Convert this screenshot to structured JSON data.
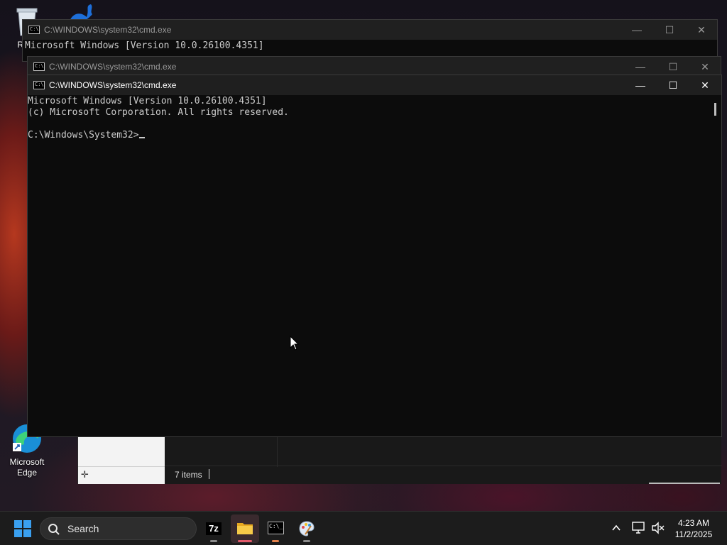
{
  "desktop": {
    "icons": [
      {
        "label": "Recy"
      },
      {
        "label": "Microsoft Edge"
      }
    ]
  },
  "explorer": {
    "status_items": "7 items"
  },
  "windows": [
    {
      "title": "C:\\WINDOWS\\system32\\cmd.exe",
      "lines": [
        "Microsoft Windows [Version 10.0.26100.4351]"
      ]
    },
    {
      "title": "C:\\WINDOWS\\system32\\cmd.exe",
      "lines": []
    },
    {
      "title": "C:\\WINDOWS\\system32\\cmd.exe",
      "lines": [
        "Microsoft Windows [Version 10.0.26100.4351]",
        "(c) Microsoft Corporation. All rights reserved.",
        "",
        "C:\\Windows\\System32>"
      ]
    }
  ],
  "window_controls": {
    "minimize": "—",
    "maximize": "☐",
    "close": "✕"
  },
  "taskbar": {
    "search_label": "Search",
    "apps": [
      {
        "name": "7-Zip",
        "glyph": "7z"
      },
      {
        "name": "File Explorer"
      },
      {
        "name": "Command Prompt",
        "glyph": "C:\\_"
      },
      {
        "name": "Paint"
      }
    ],
    "clock": {
      "time": "4:23 AM",
      "date": "11/2/2025"
    }
  },
  "colors": {
    "console_bg": "#0c0c0c",
    "console_text": "#cccccc",
    "titlebar": "#202020",
    "accent_active": "#e25a6a"
  }
}
